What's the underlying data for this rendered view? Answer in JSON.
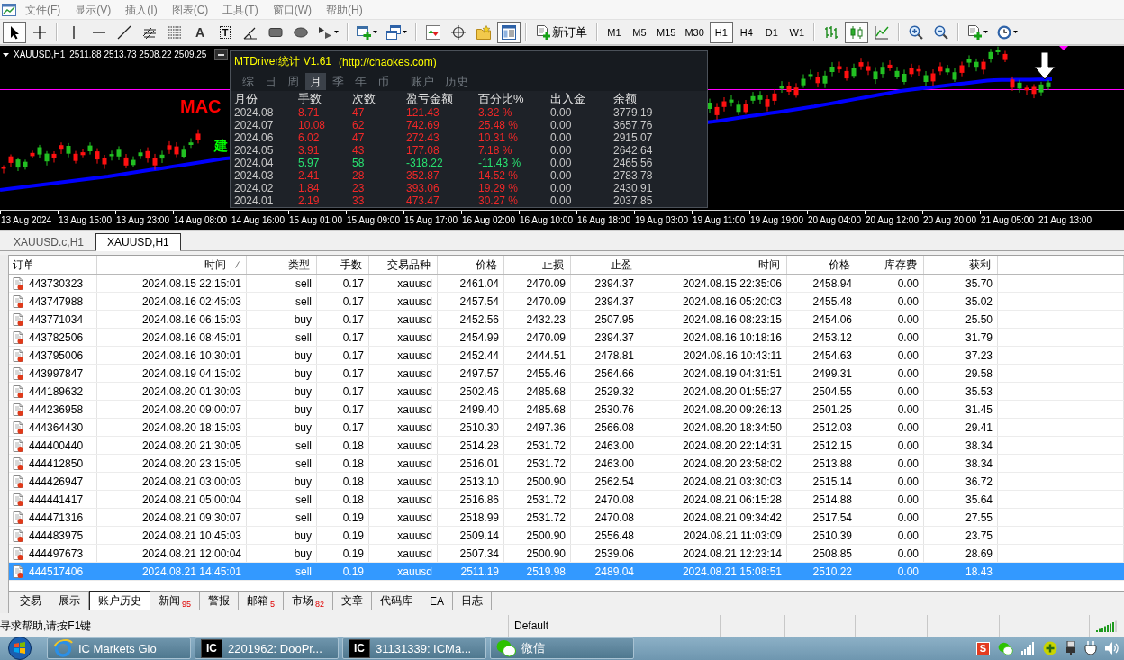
{
  "menu_bar": {
    "items": [
      "文件(F)",
      "显示(V)",
      "插入(I)",
      "图表(C)",
      "工具(T)",
      "窗口(W)",
      "帮助(H)"
    ]
  },
  "toolbar": {
    "groups": [
      [
        {
          "kind": "cursor",
          "selected": true,
          "dropdown": false
        },
        {
          "kind": "crosshair",
          "selected": false,
          "dropdown": false
        }
      ],
      [
        {
          "kind": "vertical-line",
          "selected": false,
          "dropdown": false
        },
        {
          "kind": "horizontal-line",
          "selected": false,
          "dropdown": false
        },
        {
          "kind": "trend-line",
          "selected": false,
          "dropdown": false
        },
        {
          "kind": "fibo-grid",
          "selected": false,
          "dropdown": false
        },
        {
          "kind": "fibo-lines",
          "selected": false,
          "dropdown": false
        },
        {
          "kind": "glyph",
          "glyph": "A",
          "selected": false,
          "dropdown": false
        },
        {
          "kind": "boxed-glyph",
          "glyph": "T",
          "selected": false,
          "dropdown": false
        },
        {
          "kind": "angle",
          "selected": false,
          "dropdown": false
        },
        {
          "kind": "rectangle",
          "selected": false,
          "dropdown": false
        },
        {
          "kind": "ellipse",
          "selected": false,
          "dropdown": false
        },
        {
          "kind": "arrows",
          "selected": false,
          "dropdown": true
        }
      ],
      [
        {
          "kind": "new-chart",
          "selected": false,
          "dropdown": true
        },
        {
          "kind": "profiles",
          "selected": false,
          "dropdown": true
        }
      ],
      [
        {
          "kind": "market-watch",
          "selected": false,
          "dropdown": false
        },
        {
          "kind": "navigator",
          "selected": false,
          "dropdown": false
        },
        {
          "kind": "favorites",
          "selected": false,
          "dropdown": false
        },
        {
          "kind": "terminal",
          "selected": true,
          "dropdown": false
        }
      ],
      [
        {
          "kind": "new-order",
          "label": "新订单",
          "selected": false,
          "dropdown": false
        }
      ],
      [
        {
          "kind": "timeframe",
          "label": "M1",
          "selected": false,
          "dropdown": false
        },
        {
          "kind": "timeframe",
          "label": "M5",
          "selected": false,
          "dropdown": false
        },
        {
          "kind": "timeframe",
          "label": "M15",
          "selected": false,
          "dropdown": false
        },
        {
          "kind": "timeframe",
          "label": "M30",
          "selected": false,
          "dropdown": false
        },
        {
          "kind": "timeframe",
          "label": "H1",
          "selected": true,
          "dropdown": false
        },
        {
          "kind": "timeframe",
          "label": "H4",
          "selected": false,
          "dropdown": false
        },
        {
          "kind": "timeframe",
          "label": "D1",
          "selected": false,
          "dropdown": false
        },
        {
          "kind": "timeframe",
          "label": "W1",
          "selected": false,
          "dropdown": false
        }
      ],
      [
        {
          "kind": "bar-chart",
          "selected": false,
          "dropdown": false
        },
        {
          "kind": "candle-chart",
          "selected": true,
          "dropdown": false
        },
        {
          "kind": "line-chart",
          "selected": false,
          "dropdown": false
        }
      ],
      [
        {
          "kind": "zoom-in",
          "selected": false,
          "dropdown": false
        },
        {
          "kind": "zoom-out",
          "selected": false,
          "dropdown": false
        }
      ],
      [
        {
          "kind": "templates",
          "selected": false,
          "dropdown": true
        },
        {
          "kind": "periodicity",
          "selected": false,
          "dropdown": true
        }
      ]
    ]
  },
  "chart": {
    "symbol": "XAUUSD,H1",
    "quotes": "2511.88 2513.73 2508.22 2509.25",
    "labels": [
      {
        "text": "MAC",
        "color": "#ff0000"
      },
      {
        "text": "建",
        "color": "#00ff00"
      }
    ],
    "stats_panel": {
      "title": "MTDriver统计 V1.61",
      "url": "(http://chaokes.com)",
      "tabs": [
        {
          "label": "综",
          "selected": false
        },
        {
          "label": "日",
          "selected": false
        },
        {
          "label": "周",
          "selected": false
        },
        {
          "label": "月",
          "selected": true
        },
        {
          "label": "季",
          "selected": false
        },
        {
          "label": "年",
          "selected": false
        },
        {
          "label": "币",
          "selected": false
        },
        {
          "label": "账户",
          "selected": false
        },
        {
          "label": "历史",
          "selected": false
        }
      ],
      "columns": [
        "月份",
        "手数",
        "次数",
        "盈亏金额",
        "百分比%",
        "出入金",
        "余额"
      ],
      "rows": [
        {
          "color": "#f02828",
          "cells": [
            "2024.08",
            "8.71",
            "47",
            "121.43",
            "3.32 %",
            "0.00",
            "3779.19"
          ]
        },
        {
          "color": "#f02828",
          "cells": [
            "2024.07",
            "10.08",
            "62",
            "742.69",
            "25.48 %",
            "0.00",
            "3657.76"
          ]
        },
        {
          "color": "#f02828",
          "cells": [
            "2024.06",
            "6.02",
            "47",
            "272.43",
            "10.31 %",
            "0.00",
            "2915.07"
          ]
        },
        {
          "color": "#f02828",
          "cells": [
            "2024.05",
            "3.91",
            "43",
            "177.08",
            "7.18 %",
            "0.00",
            "2642.64"
          ]
        },
        {
          "color": "#28e070",
          "cells": [
            "2024.04",
            "5.97",
            "58",
            "-318.22",
            "-11.43 %",
            "0.00",
            "2465.56"
          ]
        },
        {
          "color": "#f02828",
          "cells": [
            "2024.03",
            "2.41",
            "28",
            "352.87",
            "14.52 %",
            "0.00",
            "2783.78"
          ]
        },
        {
          "color": "#f02828",
          "cells": [
            "2024.02",
            "1.84",
            "23",
            "393.06",
            "19.29 %",
            "0.00",
            "2430.91"
          ]
        },
        {
          "color": "#f02828",
          "cells": [
            "2024.01",
            "2.19",
            "33",
            "473.47",
            "30.27 %",
            "0.00",
            "2037.85"
          ]
        }
      ]
    },
    "time_axis": [
      "13 Aug 2024",
      "13 Aug 15:00",
      "13 Aug 23:00",
      "14 Aug 08:00",
      "14 Aug 16:00",
      "15 Aug 01:00",
      "15 Aug 09:00",
      "15 Aug 17:00",
      "16 Aug 02:00",
      "16 Aug 10:00",
      "16 Aug 18:00",
      "19 Aug 03:00",
      "19 Aug 11:00",
      "19 Aug 19:00",
      "20 Aug 04:00",
      "20 Aug 12:00",
      "20 Aug 20:00",
      "21 Aug 05:00",
      "21 Aug 13:00"
    ]
  },
  "chart_tabs": [
    {
      "label": "XAUUSD.c,H1",
      "selected": false
    },
    {
      "label": "XAUUSD,H1",
      "selected": true
    }
  ],
  "terminal": {
    "columns": [
      {
        "label": "订单",
        "sorted": false
      },
      {
        "label": "时间",
        "sorted": true
      },
      {
        "label": "类型",
        "sorted": false
      },
      {
        "label": "手数",
        "sorted": false
      },
      {
        "label": "交易品种",
        "sorted": false
      },
      {
        "label": "价格",
        "sorted": false
      },
      {
        "label": "止损",
        "sorted": false
      },
      {
        "label": "止盈",
        "sorted": false
      },
      {
        "label": "时间",
        "sorted": false
      },
      {
        "label": "价格",
        "sorted": false
      },
      {
        "label": "库存费",
        "sorted": false
      },
      {
        "label": "获利",
        "sorted": false
      }
    ],
    "rows": [
      {
        "selected": false,
        "cells": [
          "443730323",
          "2024.08.15 22:15:01",
          "sell",
          "0.17",
          "xauusd",
          "2461.04",
          "2470.09",
          "2394.37",
          "2024.08.15 22:35:06",
          "2458.94",
          "0.00",
          "35.70"
        ]
      },
      {
        "selected": false,
        "cells": [
          "443747988",
          "2024.08.16 02:45:03",
          "sell",
          "0.17",
          "xauusd",
          "2457.54",
          "2470.09",
          "2394.37",
          "2024.08.16 05:20:03",
          "2455.48",
          "0.00",
          "35.02"
        ]
      },
      {
        "selected": false,
        "cells": [
          "443771034",
          "2024.08.16 06:15:03",
          "buy",
          "0.17",
          "xauusd",
          "2452.56",
          "2432.23",
          "2507.95",
          "2024.08.16 08:23:15",
          "2454.06",
          "0.00",
          "25.50"
        ]
      },
      {
        "selected": false,
        "cells": [
          "443782506",
          "2024.08.16 08:45:01",
          "sell",
          "0.17",
          "xauusd",
          "2454.99",
          "2470.09",
          "2394.37",
          "2024.08.16 10:18:16",
          "2453.12",
          "0.00",
          "31.79"
        ]
      },
      {
        "selected": false,
        "cells": [
          "443795006",
          "2024.08.16 10:30:01",
          "buy",
          "0.17",
          "xauusd",
          "2452.44",
          "2444.51",
          "2478.81",
          "2024.08.16 10:43:11",
          "2454.63",
          "0.00",
          "37.23"
        ]
      },
      {
        "selected": false,
        "cells": [
          "443997847",
          "2024.08.19 04:15:02",
          "buy",
          "0.17",
          "xauusd",
          "2497.57",
          "2455.46",
          "2564.66",
          "2024.08.19 04:31:51",
          "2499.31",
          "0.00",
          "29.58"
        ]
      },
      {
        "selected": false,
        "cells": [
          "444189632",
          "2024.08.20 01:30:03",
          "buy",
          "0.17",
          "xauusd",
          "2502.46",
          "2485.68",
          "2529.32",
          "2024.08.20 01:55:27",
          "2504.55",
          "0.00",
          "35.53"
        ]
      },
      {
        "selected": false,
        "cells": [
          "444236958",
          "2024.08.20 09:00:07",
          "buy",
          "0.17",
          "xauusd",
          "2499.40",
          "2485.68",
          "2530.76",
          "2024.08.20 09:26:13",
          "2501.25",
          "0.00",
          "31.45"
        ]
      },
      {
        "selected": false,
        "cells": [
          "444364430",
          "2024.08.20 18:15:03",
          "buy",
          "0.17",
          "xauusd",
          "2510.30",
          "2497.36",
          "2566.08",
          "2024.08.20 18:34:50",
          "2512.03",
          "0.00",
          "29.41"
        ]
      },
      {
        "selected": false,
        "cells": [
          "444400440",
          "2024.08.20 21:30:05",
          "sell",
          "0.18",
          "xauusd",
          "2514.28",
          "2531.72",
          "2463.00",
          "2024.08.20 22:14:31",
          "2512.15",
          "0.00",
          "38.34"
        ]
      },
      {
        "selected": false,
        "cells": [
          "444412850",
          "2024.08.20 23:15:05",
          "sell",
          "0.18",
          "xauusd",
          "2516.01",
          "2531.72",
          "2463.00",
          "2024.08.20 23:58:02",
          "2513.88",
          "0.00",
          "38.34"
        ]
      },
      {
        "selected": false,
        "cells": [
          "444426947",
          "2024.08.21 03:00:03",
          "buy",
          "0.18",
          "xauusd",
          "2513.10",
          "2500.90",
          "2562.54",
          "2024.08.21 03:30:03",
          "2515.14",
          "0.00",
          "36.72"
        ]
      },
      {
        "selected": false,
        "cells": [
          "444441417",
          "2024.08.21 05:00:04",
          "sell",
          "0.18",
          "xauusd",
          "2516.86",
          "2531.72",
          "2470.08",
          "2024.08.21 06:15:28",
          "2514.88",
          "0.00",
          "35.64"
        ]
      },
      {
        "selected": false,
        "cells": [
          "444471316",
          "2024.08.21 09:30:07",
          "sell",
          "0.19",
          "xauusd",
          "2518.99",
          "2531.72",
          "2470.08",
          "2024.08.21 09:34:42",
          "2517.54",
          "0.00",
          "27.55"
        ]
      },
      {
        "selected": false,
        "cells": [
          "444483975",
          "2024.08.21 10:45:03",
          "buy",
          "0.19",
          "xauusd",
          "2509.14",
          "2500.90",
          "2556.48",
          "2024.08.21 11:03:09",
          "2510.39",
          "0.00",
          "23.75"
        ]
      },
      {
        "selected": false,
        "cells": [
          "444497673",
          "2024.08.21 12:00:04",
          "buy",
          "0.19",
          "xauusd",
          "2507.34",
          "2500.90",
          "2539.06",
          "2024.08.21 12:23:14",
          "2508.85",
          "0.00",
          "28.69"
        ]
      },
      {
        "selected": true,
        "cells": [
          "444517406",
          "2024.08.21 14:45:01",
          "sell",
          "0.19",
          "xauusd",
          "2511.19",
          "2519.98",
          "2489.04",
          "2024.08.21 15:08:51",
          "2510.22",
          "0.00",
          "18.43"
        ]
      }
    ],
    "tabs": [
      {
        "label": "交易",
        "selected": false
      },
      {
        "label": "展示",
        "selected": false
      },
      {
        "label": "账户历史",
        "selected": true
      },
      {
        "label": "新闻",
        "count": "95",
        "selected": false
      },
      {
        "label": "警报",
        "selected": false
      },
      {
        "label": "邮箱",
        "count": "5",
        "selected": false
      },
      {
        "label": "市场",
        "count": "82",
        "selected": false
      },
      {
        "label": "文章",
        "selected": false
      },
      {
        "label": "代码库",
        "selected": false
      },
      {
        "label": "EA",
        "selected": false
      },
      {
        "label": "日志",
        "selected": false
      }
    ]
  },
  "status_bar": {
    "help_text": "寻求帮助,请按F1键",
    "profile": "Default"
  },
  "taskbar": {
    "tasks": [
      {
        "kind": "browser",
        "label": "IC Markets Glo"
      },
      {
        "kind": "trading-terminal",
        "icon_text": "IC",
        "label": "2201962: DooPr..."
      },
      {
        "kind": "trading-terminal",
        "icon_text": "IC",
        "label": "31131339: ICMa..."
      },
      {
        "kind": "messenger",
        "label": "微信"
      }
    ],
    "tray": {
      "ime_text": "S"
    }
  }
}
